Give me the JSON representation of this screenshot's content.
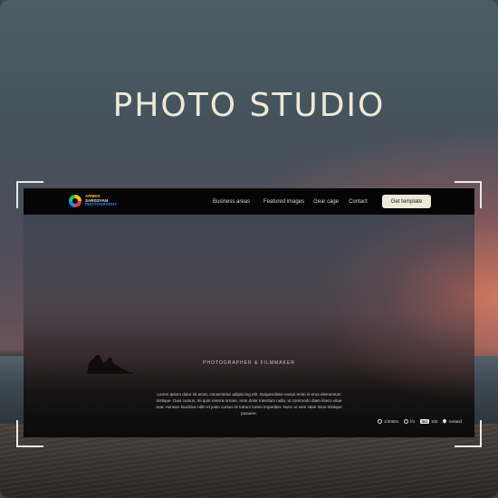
{
  "page": {
    "title": "PHOTO STUDIO"
  },
  "logo": {
    "line1": "ARMEN",
    "line2": "SARGSYAN",
    "line3": "PHOTOGRAPHY"
  },
  "nav": {
    "items": [
      "Business areas",
      "Featured images",
      "Gear cage",
      "Contact"
    ],
    "cta": "Get template"
  },
  "hero": {
    "kicker": "PHOTOGRAPHER & FILMMAKER",
    "description": "Lorem ipsum dolor sit amet, consectetur adipiscing elit. Suspendisse varius enim in eros elementum tristique. Duis cursus, mi quis viverra ornare, eros dolor interdum nulla, ut commodo diam libero vitae erat. Aenean faucibus nibh et justo cursus id rutrum lorem imperdiet. Nunc ut sem vitae risus tristique posuere."
  },
  "meta": {
    "shutter": "1/2000s",
    "aperture": "f/4",
    "iso_label": "ISO",
    "iso_value": "100",
    "location": "Iceland"
  },
  "colors": {
    "accent": "#ecead7",
    "nav_bg": "#050505"
  }
}
